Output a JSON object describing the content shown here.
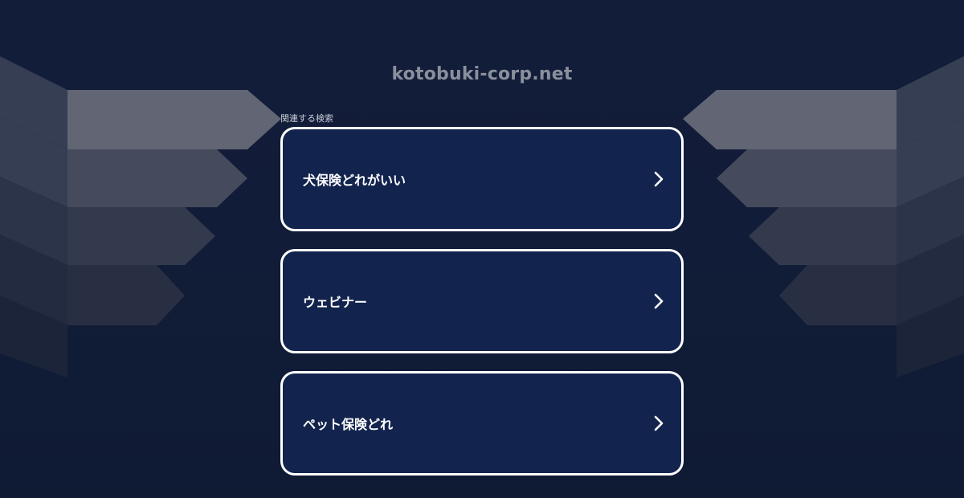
{
  "header": {
    "domain": "kotobuki-corp.net"
  },
  "related": {
    "label": "関連する検索",
    "items": [
      {
        "label": "犬保険どれがいい"
      },
      {
        "label": "ウェビナー"
      },
      {
        "label": "ペット保険どれ"
      }
    ]
  },
  "colors": {
    "background": "#111c38",
    "card_fill": "#12244e",
    "card_border": "#ffffff",
    "domain_text": "#8a8f9c"
  },
  "icons": {
    "card_arrow": "chevron-right-icon"
  }
}
